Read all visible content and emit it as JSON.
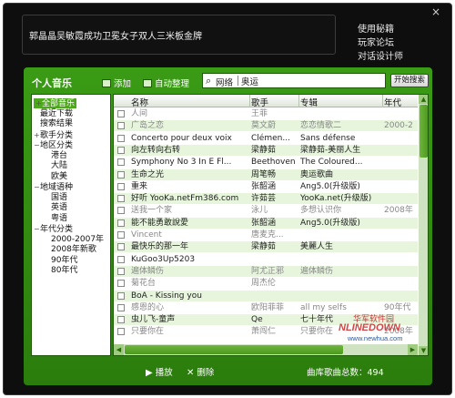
{
  "window": {
    "close_label": "×",
    "now_playing": "郭晶晶吴敏霞成功卫冕女子双人三米板金牌",
    "top_links": [
      "使用秘籍",
      "玩家论坛",
      "对话设计师"
    ]
  },
  "toolbar": {
    "tab_label": "个人音乐",
    "add_label": "添加",
    "organize_label": "自动整理",
    "search_scope": "网络",
    "search_value": "奥运",
    "search_button": "开始搜索"
  },
  "tree": [
    {
      "label": "全部音乐",
      "toggle": "+",
      "level": 0,
      "selected": true
    },
    {
      "label": "最近下载",
      "toggle": "",
      "level": 0
    },
    {
      "label": "搜索结果",
      "toggle": "",
      "level": 0
    },
    {
      "label": "歌手分类",
      "toggle": "+",
      "level": 0
    },
    {
      "label": "地区分类",
      "toggle": "−",
      "level": 0
    },
    {
      "label": "港台",
      "toggle": "",
      "level": 1
    },
    {
      "label": "大陆",
      "toggle": "",
      "level": 1
    },
    {
      "label": "欧美",
      "toggle": "",
      "level": 1
    },
    {
      "label": "地域语种",
      "toggle": "−",
      "level": 0
    },
    {
      "label": "国语",
      "toggle": "",
      "level": 1
    },
    {
      "label": "英语",
      "toggle": "",
      "level": 1
    },
    {
      "label": "粤语",
      "toggle": "",
      "level": 1
    },
    {
      "label": "年代分类",
      "toggle": "−",
      "level": 0
    },
    {
      "label": "2000-2007年",
      "toggle": "",
      "level": 1
    },
    {
      "label": "2008年新歌",
      "toggle": "",
      "level": 1
    },
    {
      "label": "90年代",
      "toggle": "",
      "level": 1
    },
    {
      "label": "80年代",
      "toggle": "",
      "level": 1
    }
  ],
  "list": {
    "columns": [
      "名称",
      "歌手",
      "专辑",
      "年代"
    ],
    "rows": [
      {
        "name": "人间",
        "artist": "王菲",
        "album": "",
        "year": "",
        "grey": true
      },
      {
        "name": "广岛之恋",
        "artist": "莫文蔚",
        "album": "恋恋情歌二",
        "year": "2000-2",
        "grey": true
      },
      {
        "name": "Concerto pour deux voix",
        "artist": "Clémen...",
        "album": "Sans défense",
        "year": ""
      },
      {
        "name": "向左转向右转",
        "artist": "梁静茹",
        "album": "梁静茹-美丽人生",
        "year": ""
      },
      {
        "name": "Symphony No 3 In E Fl...",
        "artist": "Beethoven",
        "album": "The Coloured...",
        "year": ""
      },
      {
        "name": "生命之光",
        "artist": "周笔畅",
        "album": "奥运歌曲",
        "year": ""
      },
      {
        "name": "重来",
        "artist": "张韶涵",
        "album": "Ang5.0(升级版)",
        "year": ""
      },
      {
        "name": "好听 YooKa.netFm386.com",
        "artist": "许茹芸",
        "album": "YooKa.net(升级版)",
        "year": ""
      },
      {
        "name": "送我一个家",
        "artist": "泳儿",
        "album": "多想认识你",
        "year": "2008年",
        "grey": true
      },
      {
        "name": "能不能勇敢說愛",
        "artist": "张韶涵",
        "album": "Ang5.0(升级版)",
        "year": ""
      },
      {
        "name": "Vincent",
        "artist": "唐麦克...",
        "album": "",
        "year": "",
        "grey": true
      },
      {
        "name": "最快乐的那一年",
        "artist": "梁静茹",
        "album": "美麗人生",
        "year": ""
      },
      {
        "name": "KuGoo3Up5203",
        "artist": "",
        "album": "",
        "year": ""
      },
      {
        "name": "遍体鳞伤",
        "artist": "阿尤正邪",
        "album": "遍体鳞伤",
        "year": "",
        "grey": true
      },
      {
        "name": "菊花台",
        "artist": "周杰伦",
        "album": "",
        "year": "",
        "grey": true
      },
      {
        "name": "BoA - Kissing you",
        "artist": "",
        "album": "",
        "year": ""
      },
      {
        "name": "感恩的心",
        "artist": "欧阳菲菲",
        "album": "all my selfs",
        "year": "90年代",
        "grey": true
      },
      {
        "name": "虫儿飞-童声",
        "artist": "Qe",
        "album": "七十年代",
        "year": "",
        "grey": false
      },
      {
        "name": "只要你在",
        "artist": "萧闯仁",
        "album": "只要你在",
        "year": "2008年",
        "grey": true
      }
    ]
  },
  "bottom": {
    "play_label": "播放",
    "delete_label": "删除",
    "count_label": "曲库歌曲总数：494"
  },
  "watermark": {
    "zh": "华军软件园",
    "brand": "NLINEDOWN",
    "site": "www.newhua.com"
  }
}
